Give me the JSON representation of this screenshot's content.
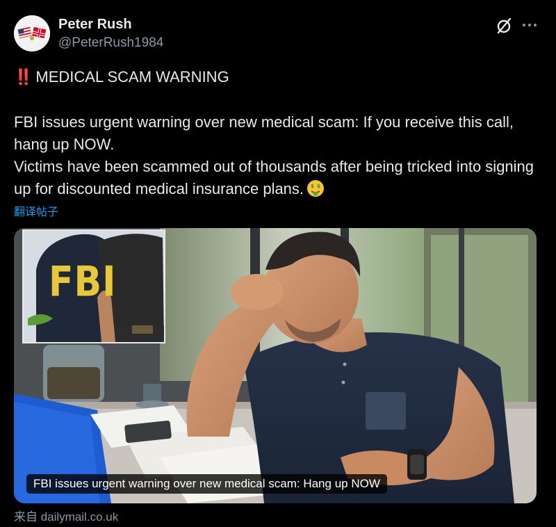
{
  "author": {
    "display_name": "Peter Rush",
    "handle": "@PeterRush1984",
    "avatar_icon": "flag-pins-avatar"
  },
  "post": {
    "headline_prefix": "‼️",
    "headline": "MEDICAL SCAM WARNING",
    "paragraph1": "FBI issues urgent warning over new medical scam: If you receive this call, hang up NOW.",
    "paragraph2": "Victims have been scammed out of thousands after being tricked into signing up for discounted medical insurance plans.",
    "emoji": "money-mouth-face-emoji",
    "translate_link": "翻译帖子"
  },
  "card": {
    "caption": "FBI issues urgent warning over new medical scam: Hang up NOW",
    "inset_text": "FBI",
    "source": "来自 dailymail.co.uk"
  },
  "colors": {
    "background": "#000000",
    "text": "#e7e9ea",
    "secondary": "#8b98a5",
    "link": "#1d9bf0",
    "alarm": "#f4212e"
  }
}
